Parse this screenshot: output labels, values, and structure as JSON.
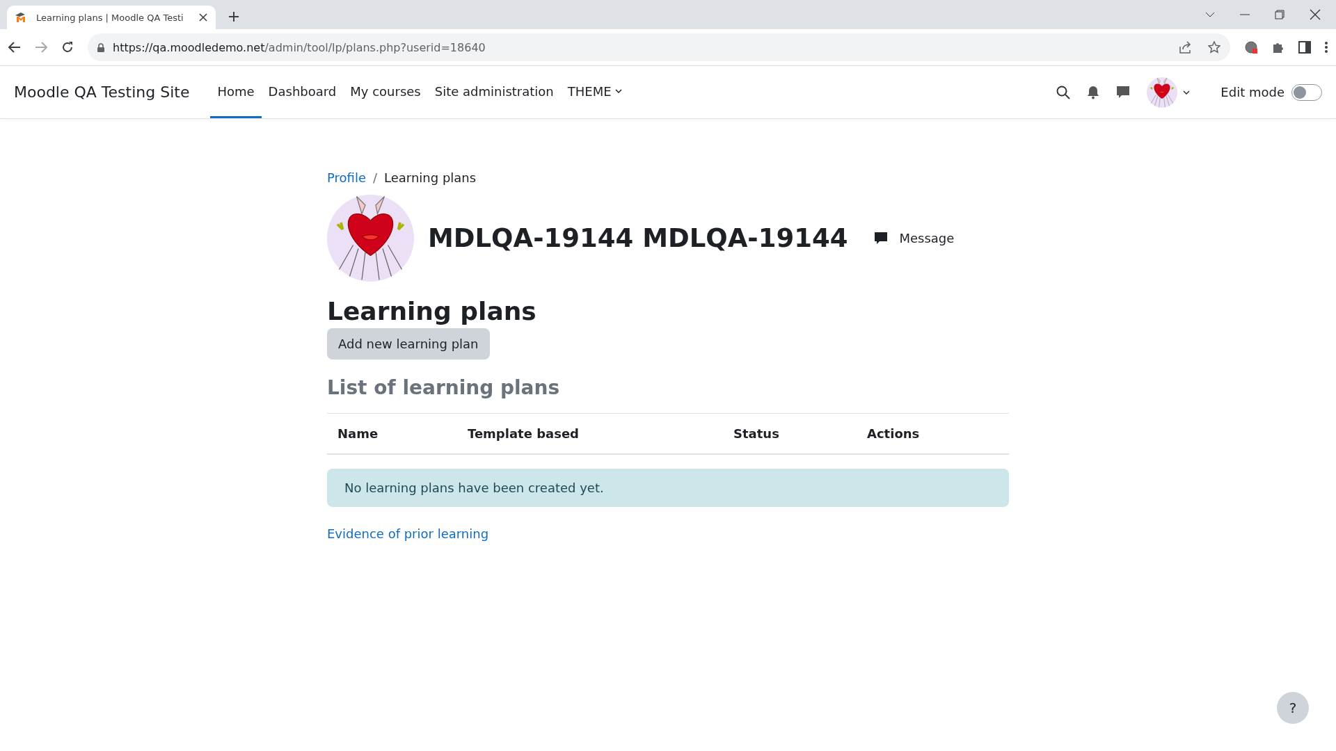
{
  "browser": {
    "tab": {
      "title": "Learning plans | Moodle QA Testi",
      "selected": true
    },
    "url": {
      "host": "https://qa.moodledemo.net",
      "path": "/admin/tool/lp/plans.php?userid=18640"
    }
  },
  "navbar": {
    "site_name": "Moodle QA Testing Site",
    "items": [
      {
        "label": "Home",
        "selected": true,
        "dropdown": false
      },
      {
        "label": "Dashboard",
        "selected": false,
        "dropdown": false
      },
      {
        "label": "My courses",
        "selected": false,
        "dropdown": false
      },
      {
        "label": "Site administration",
        "selected": false,
        "dropdown": false
      },
      {
        "label": "THEME",
        "selected": false,
        "dropdown": true
      }
    ],
    "edit_mode": {
      "label": "Edit mode",
      "on": false
    }
  },
  "breadcrumb_separator": "/",
  "breadcrumb": [
    {
      "label": "Profile",
      "link": true
    },
    {
      "label": "Learning plans",
      "link": false
    }
  ],
  "user": {
    "name": "MDLQA-19144 MDLQA-19144",
    "message": "Message"
  },
  "heading": "Learning plans",
  "add_button": "Add new learning plan",
  "section_title": "List of learning plans",
  "table": {
    "columns": [
      "Name",
      "Template based",
      "Status",
      "Actions"
    ]
  },
  "alert": "No learning plans have been created yet.",
  "footer_link": "Evidence of prior learning",
  "help": "?"
}
